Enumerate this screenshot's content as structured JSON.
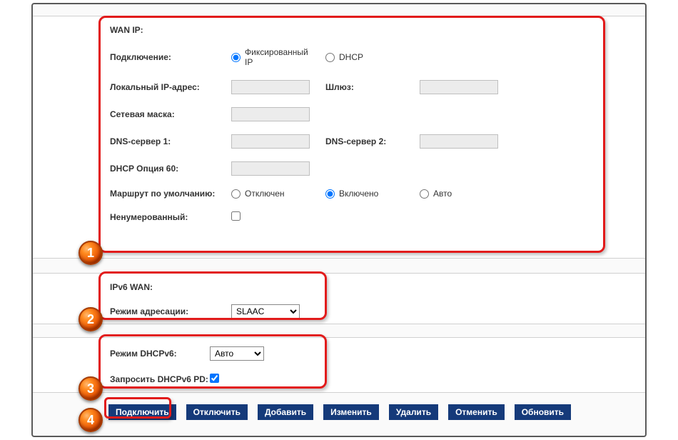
{
  "wan_ip": {
    "title": "WAN IP:",
    "connection_label": "Подключение:",
    "connection_fixed": "Фиксированный IP",
    "connection_dhcp": "DHCP",
    "local_ip_label": "Локальный IP-адрес:",
    "local_ip_value": "",
    "gateway_label": "Шлюз:",
    "gateway_value": "",
    "netmask_label": "Сетевая маска:",
    "netmask_value": "",
    "dns1_label": "DNS-сервер 1:",
    "dns1_value": "",
    "dns2_label": "DNS-сервер 2:",
    "dns2_value": "",
    "dhcp60_label": "DHCP Опция 60:",
    "dhcp60_value": "",
    "route_label": "Маршрут по умолчанию:",
    "route_off": "Отключен",
    "route_on": "Включено",
    "route_auto": "Авто",
    "unnumbered_label": "Ненумерованный:"
  },
  "ipv6_wan": {
    "title": "IPv6 WAN:",
    "addr_mode_label": "Режим адресации:",
    "addr_mode_value": "SLAAC"
  },
  "dhcpv6": {
    "mode_label": "Режим DHCPv6:",
    "mode_value": "Авто",
    "pd_label": "Запросить DHCPv6 PD:"
  },
  "buttons": {
    "connect": "Подключить",
    "disconnect": "Отключить",
    "add": "Добавить",
    "edit": "Изменить",
    "delete": "Удалить",
    "cancel": "Отменить",
    "refresh": "Обновить"
  },
  "markers": {
    "m1": "1",
    "m2": "2",
    "m3": "3",
    "m4": "4"
  }
}
